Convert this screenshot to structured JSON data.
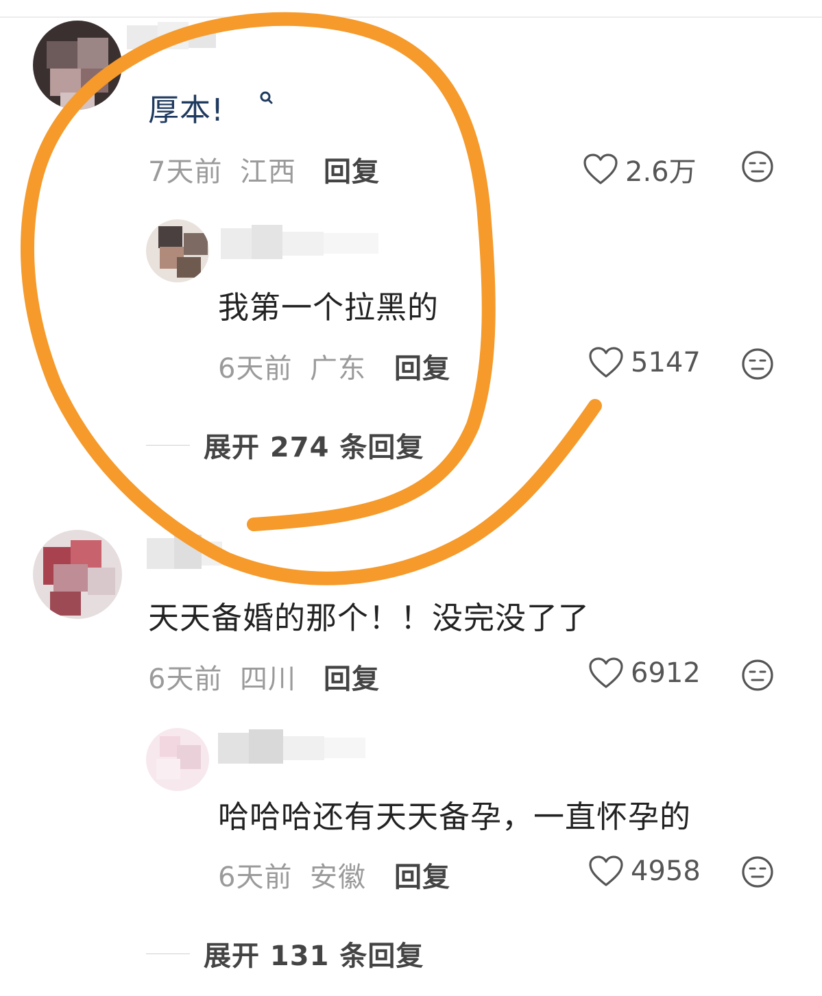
{
  "comments": [
    {
      "content": "厚本!",
      "time": "7天前",
      "region": "江西",
      "reply_label": "回复",
      "likes": "2.6万",
      "reply": {
        "content": "我第一个拉黑的",
        "time": "6天前",
        "region": "广东",
        "reply_label": "回复",
        "likes": "5147"
      },
      "expand_label": "展开 274 条回复"
    },
    {
      "content": "天天备婚的那个！！没完没了了",
      "time": "6天前",
      "region": "四川",
      "reply_label": "回复",
      "likes": "6912",
      "reply": {
        "content": "哈哈哈还有天天备孕，一直怀孕的",
        "time": "6天前",
        "region": "安徽",
        "reply_label": "回复",
        "likes": "4958"
      },
      "expand_label": "展开 131 条回复"
    }
  ],
  "colors": {
    "annotation": "#F59A2B",
    "link_text": "#1f3a5f",
    "meta": "#9a9a9a"
  },
  "icons": [
    "search-icon",
    "heart-icon",
    "expressionless-face-icon"
  ]
}
